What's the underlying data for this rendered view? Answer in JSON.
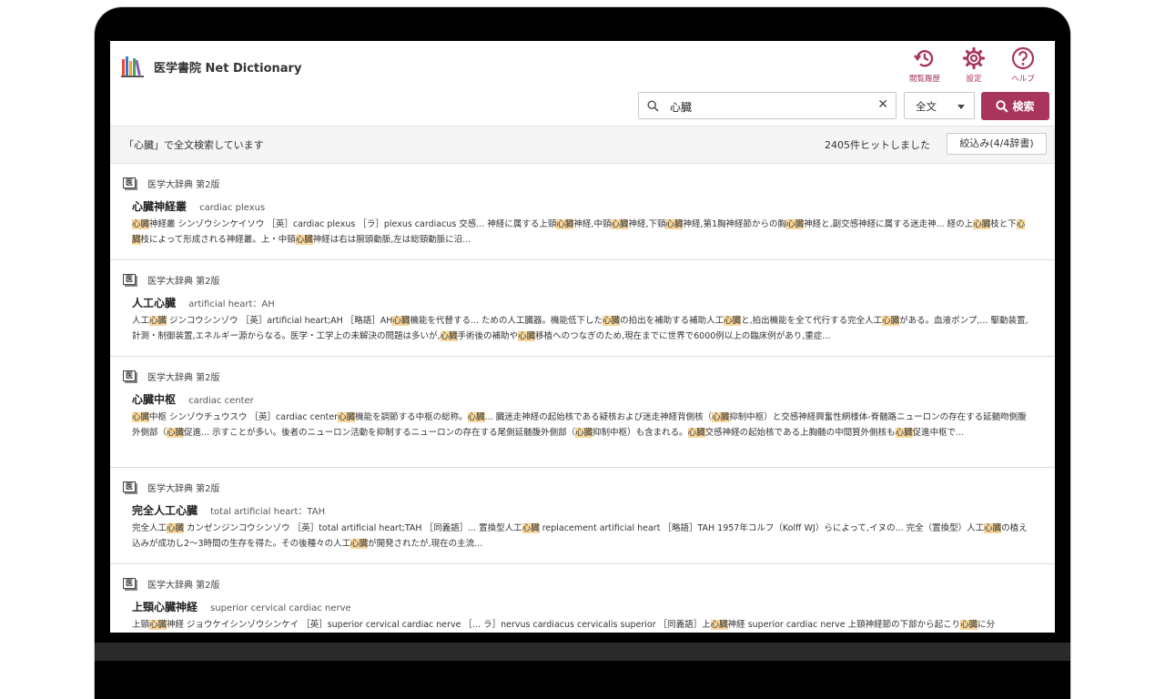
{
  "app": {
    "title": "医学書院 Net Dictionary"
  },
  "header": {
    "icons": [
      {
        "name": "history-icon",
        "label": "閲覧履歴"
      },
      {
        "name": "gear-icon",
        "label": "設定"
      },
      {
        "name": "help-icon",
        "label": "ヘルプ"
      }
    ]
  },
  "search": {
    "value": "心臓",
    "mode": "全文",
    "button_label": "検索",
    "clear_symbol": "✕"
  },
  "status": {
    "message": "「心臓」で全文検索しています",
    "hits": "2405件ヒットしました",
    "filter_label": "絞込み(4/4辞書)"
  },
  "colors": {
    "accent": "#a8355c",
    "highlight": "#f7d79c"
  },
  "results": [
    {
      "badge": "医",
      "source": "医学大辞典 第2版",
      "term": "心臓神経叢",
      "en": "cardiac plexus",
      "snippet": "[[心臓]]神経叢 シンゾウシンケイソウ ［英］cardiac plexus ［ラ］plexus cardiacus 交感... 神経に属する上頸[[心臓]]神経,中頸[[心臓]]神経,下頸[[心臓]]神経,第1胸神経節からの胸[[心臓]]神経と,副交感神経に属する迷走神... 経の上[[心臓]]枝と下[[心臓]]枝によって形成される神経叢。上・中頸[[心臓]]神経は右は腕頭動脈,左は総頸動脈に沿..."
    },
    {
      "badge": "医",
      "source": "医学大辞典 第2版",
      "term": "人工心臓",
      "en": "artificial heart：AH",
      "snippet": "人工[[心臓]] ジンコウシンゾウ ［英］artificial heart;AH ［略語］AH[[心臓]]機能を代替する... ための人工臓器。機能低下した[[心臓]]の拍出を補助する補助人工[[心臓]]と,拍出機能を全て代行する完全人工[[心臓]]がある。血液ポンプ,... 駆動装置,計測・制御装置,エネルギー源からなる。医学・工学上の未解決の問題は多いが,[[心臓]]手術後の補助や[[心臓]]移植へのつなぎのため,現在までに世界で6000例以上の臨床例があり,重症..."
    },
    {
      "badge": "医",
      "source": "医学大辞典 第2版",
      "term": "心臓中枢",
      "en": "cardiac center",
      "snippet": "[[心臓]]中枢 シンゾウチュウスウ ［英］cardiac center[[心臓]]機能を調節する中枢の総称。[[心臓]]... 臓迷走神経の起始核である疑核および迷走神経背側核（[[心臓]]抑制中枢）と交感神経興奮性網様体-脊髄路ニューロンの存在する延髄吻側腹外側部（[[心臓]]促進... 示すことが多い。後者のニューロン活動を抑制するニューロンの存在する尾側延髄腹外側部（[[心臓]]抑制中枢）も含まれる。[[心臓]]交感神経の起始核である上胸髄の中間質外側核も[[心臓]]促進中枢で..."
    },
    {
      "badge": "医",
      "source": "医学大辞典 第2版",
      "term": "完全人工心臓",
      "en": "total artificial heart：TAH",
      "snippet": "完全人工[[心臓]] カンゼンジンコウシンゾウ ［英］total artificial heart;TAH ［同義語］... 置換型人工[[心臓]] replacement artificial heart ［略語］TAH 1957年コルフ（Kolff WJ）らによって,イヌの... 完全（置換型）人工[[心臓]]の植え込みが成功し2〜3時間の生存を得た。その後種々の人工[[心臓]]が開発されたが,現在の主流..."
    },
    {
      "badge": "医",
      "source": "医学大辞典 第2版",
      "term": "上頸心臓神経",
      "en": "superior cervical cardiac nerve",
      "snippet": "上頸[[心臓]]神経 ジョウケイシンゾウシンケイ ［英］superior cervical cardiac nerve ［... ラ］nervus cardiacus cervicalis superior ［同義語］上[[心臓]]神経 superior cardiac nerve 上頸神経節の下部から起こり[[心臓]]に分"
    }
  ]
}
